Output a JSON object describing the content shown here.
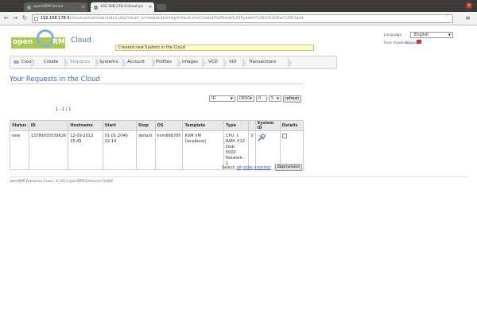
{
  "browser": {
    "tabs": [
      {
        "label": "openQRM Server"
      },
      {
        "label": "192.168.178.5/cloud-po"
      }
    ],
    "url_host": "192.168.178.5",
    "url_path": "/cloud-portal/user/index.php?cloud_ui=requests&msg=cloud-ui+Created%20new%20System%20in%20the%20Cloud"
  },
  "header": {
    "logo_open": "open",
    "logo_rm": "RM",
    "logo_cloud": "Cloud",
    "notice": "Created new System in the Cloud",
    "language_label": "Language",
    "language_value": "English",
    "user_label": "User mysecre",
    "logout_label": "Logout"
  },
  "nav": {
    "items": [
      {
        "label": "Cloud"
      },
      {
        "label": "Create"
      },
      {
        "label": "Requests"
      },
      {
        "label": "Systems"
      },
      {
        "label": "Account"
      },
      {
        "label": "Profiles"
      },
      {
        "label": "Images"
      },
      {
        "label": "VCD"
      },
      {
        "label": "VID"
      },
      {
        "label": "Transactions"
      }
    ],
    "active_index": 2
  },
  "main": {
    "title": "Your Requests in the Cloud",
    "filters": {
      "sort_by": "ID",
      "order": "DESC",
      "offset": "0",
      "limit": "5",
      "refresh_label": "refresh"
    },
    "pager": "1 - 1 / 1",
    "table": {
      "headers": [
        "Status",
        "ID",
        "Hostname",
        "Start",
        "Stop",
        "OS",
        "Template",
        "Type",
        "",
        "System ID",
        "Details"
      ],
      "rows": [
        {
          "status": "new",
          "id": "13789935539626",
          "hostname": "12-09-2013 15:45",
          "start": "01-01-2040 02:19",
          "stop": "default",
          "os": "kvm868785",
          "template": "KVM VM (localboot)",
          "type": [
            "CPU: 1",
            "RAM: 512",
            "Disk: 5000",
            "Network: 1"
          ],
          "extra": "0",
          "system_id_icon": "wrench-icon"
        }
      ]
    },
    "select_label": "Select:",
    "select_all": "all",
    "select_none": "none",
    "select_inverted": "inverted",
    "deprovision_label": "deprovision"
  },
  "footer": {
    "text": "openQRM Enterprise Cloud - © 2013 openQRM Enterprise GmbH"
  }
}
